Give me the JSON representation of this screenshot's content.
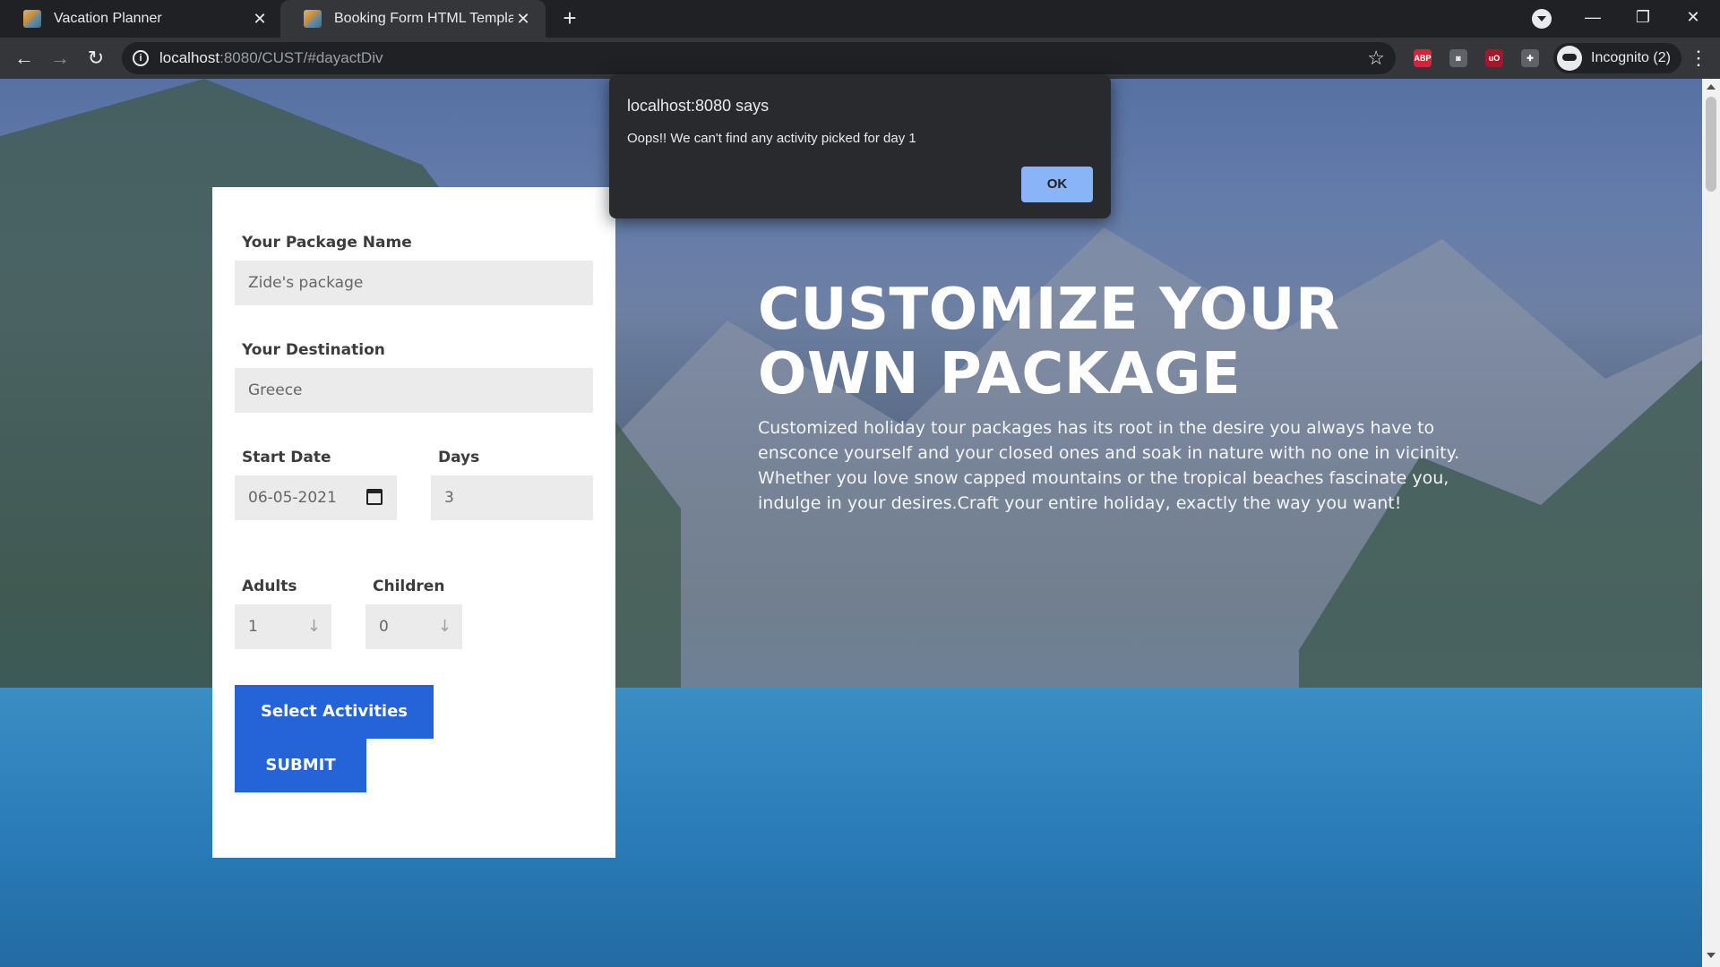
{
  "browser": {
    "tabs": [
      {
        "title": "Vacation Planner",
        "active": false
      },
      {
        "title": "Booking Form HTML Template",
        "active": true
      }
    ],
    "close_glyph": "✕",
    "new_tab_glyph": "+",
    "url_host": "localhost",
    "url_path": ":8080/CUST/#dayactDiv",
    "incognito_label": "Incognito (2)",
    "window": {
      "minimize": "—",
      "restore": "❐",
      "close": "✕"
    },
    "nav": {
      "back": "←",
      "forward": "→",
      "reload": "↻",
      "star": "☆",
      "menu": "⋮",
      "info": "i"
    },
    "extensions": [
      {
        "name": "abp-icon",
        "label": "ABP",
        "color": "#d0263b"
      },
      {
        "name": "camera-icon",
        "label": "◙",
        "color": "#9aa0a6"
      },
      {
        "name": "ublock-icon",
        "label": "uO",
        "color": "#a3172c"
      },
      {
        "name": "puzzle-icon",
        "label": "✚",
        "color": "#9aa0a6"
      }
    ]
  },
  "form": {
    "package_label": "Your Package Name",
    "package_value": "Zide's package",
    "destination_label": "Your Destination",
    "destination_value": "Greece",
    "start_date_label": "Start Date",
    "start_date_value": "06-05-2021",
    "days_label": "Days",
    "days_value": "3",
    "adults_label": "Adults",
    "adults_value": "1",
    "children_label": "Children",
    "children_value": "0",
    "spin_glyph": "↓",
    "select_activities_label": "Select Activities",
    "submit_label": "SUBMIT"
  },
  "hero": {
    "title_line1": "CUSTOMIZE YOUR",
    "title_line2": "OWN PACKAGE",
    "text": "Customized holiday tour packages has its root in the desire you always have to ensconce yourself and your closed ones and soak in nature with no one in vicinity. Whether you love snow capped mountains or the tropical beaches fascinate you, indulge in your desires.Craft your entire holiday, exactly the way you want!"
  },
  "dialog": {
    "title": "localhost:8080 says",
    "message": "Oops!! We can't find any activity picked for day 1",
    "ok_label": "OK"
  },
  "colors": {
    "accent_button": "#2563d8",
    "dialog_ok": "#8ab4f8",
    "chrome_dark": "#202124"
  }
}
